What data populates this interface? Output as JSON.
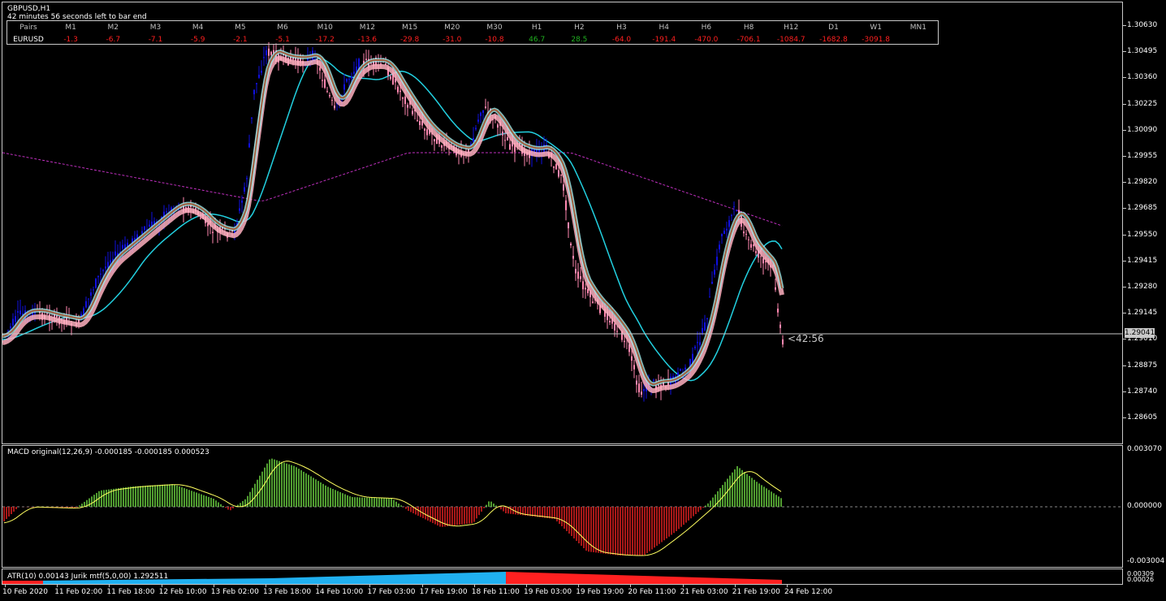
{
  "chart": {
    "symbol_title": "GBPUSD,H1",
    "countdown_text": "42 minutes 56 seconds left to bar end",
    "countdown_tag": "<42:56",
    "current_price": "1.29041"
  },
  "pairs_table": {
    "headers": [
      "Pairs",
      "M1",
      "M2",
      "M3",
      "M4",
      "M5",
      "M6",
      "M10",
      "M12",
      "M15",
      "M20",
      "M30",
      "H1",
      "H2",
      "H3",
      "H4",
      "H6",
      "H8",
      "H12",
      "D1",
      "W1",
      "MN1"
    ],
    "row_label": "EURUSD",
    "values": [
      "-1.3",
      "-6.7",
      "-7.1",
      "-5.9",
      "-2.1",
      "-5.1",
      "-17.2",
      "-13.6",
      "-29.8",
      "-31.0",
      "-10.8",
      "46.7",
      "28.5",
      "-64.0",
      "-191.4",
      "-470.0",
      "-706.1",
      "-1084.7",
      "-1682.8",
      "-3091.8",
      ""
    ],
    "colors": [
      "neg",
      "neg",
      "neg",
      "neg",
      "neg",
      "neg",
      "neg",
      "neg",
      "neg",
      "neg",
      "neg",
      "pos",
      "pos",
      "neg",
      "neg",
      "neg",
      "neg",
      "neg",
      "neg",
      "neg",
      ""
    ]
  },
  "price_axis": [
    "1.30630",
    "1.30495",
    "1.30360",
    "1.30225",
    "1.30090",
    "1.29955",
    "1.29820",
    "1.29685",
    "1.29550",
    "1.29415",
    "1.29280",
    "1.29145",
    "1.29010",
    "1.28875",
    "1.28740",
    "1.28605"
  ],
  "macd": {
    "title": "MACD original(12,26,9) -0.000185 -0.000185 0.000523",
    "axis": [
      "0.003070",
      "0.000000",
      "-0.003004"
    ]
  },
  "atr": {
    "title": "ATR(10) 0.00143 Jurik mtf(5,0,00) 1.292511",
    "axis": [
      "0.00309",
      "0.00026"
    ]
  },
  "time_axis": [
    "10 Feb 2020",
    "11 Feb 02:00",
    "11 Feb 18:00",
    "12 Feb 10:00",
    "13 Feb 02:00",
    "13 Feb 18:00",
    "14 Feb 10:00",
    "17 Feb 03:00",
    "17 Feb 19:00",
    "18 Feb 11:00",
    "19 Feb 03:00",
    "19 Feb 19:00",
    "20 Feb 11:00",
    "21 Feb 03:00",
    "21 Feb 19:00",
    "24 Feb 12:00"
  ],
  "colors": {
    "bull": "#1010e0",
    "bear": "#ff88b0",
    "ma_cyan": "#22d0e0",
    "ma_magenta": "#c030c0",
    "macd_pos": "#6bd040",
    "macd_neg": "#e02020",
    "signal": "#ffff60",
    "atr_blue": "#20b0f0",
    "atr_red": "#ff2020"
  }
}
